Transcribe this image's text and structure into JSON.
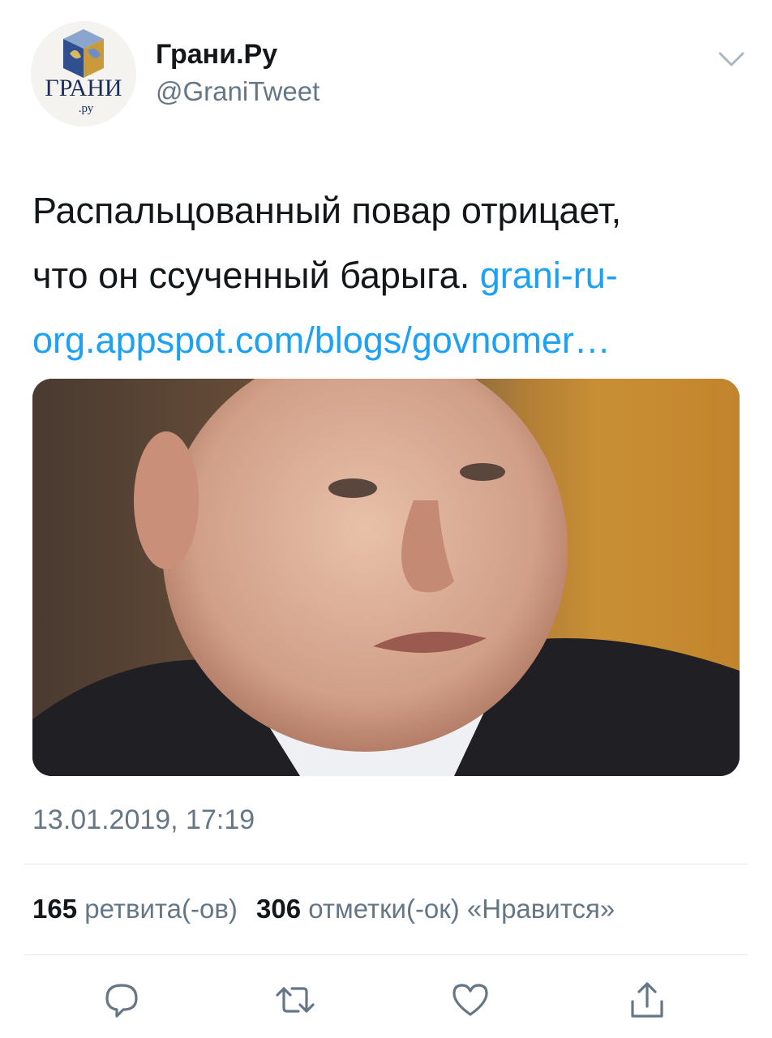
{
  "author": {
    "name": "Грани.Ру",
    "handle": "@GraniTweet",
    "avatar_text": "ГРАНИ",
    "avatar_subtext": ".ру"
  },
  "tweet": {
    "text_line1": "Распальцованный повар отрицает,",
    "text_line2_plain": "что он ссученный барыга. ",
    "link_part1": "grani-ru-",
    "link_part2": "org.appspot.com/blogs/govnomer…",
    "timestamp": "13.01.2019, 17:19"
  },
  "stats": {
    "retweets_count": "165",
    "retweets_label": "ретвита(-ов)",
    "likes_count": "306",
    "likes_label": "отметки(-ок) «Нравится»"
  },
  "actions": {
    "icons": [
      "reply-icon",
      "retweet-icon",
      "like-icon",
      "share-icon"
    ]
  },
  "colors": {
    "link": "#1da1f2",
    "secondary_text": "#657786",
    "primary_text": "#14171a",
    "divider": "#e1e8ed"
  }
}
